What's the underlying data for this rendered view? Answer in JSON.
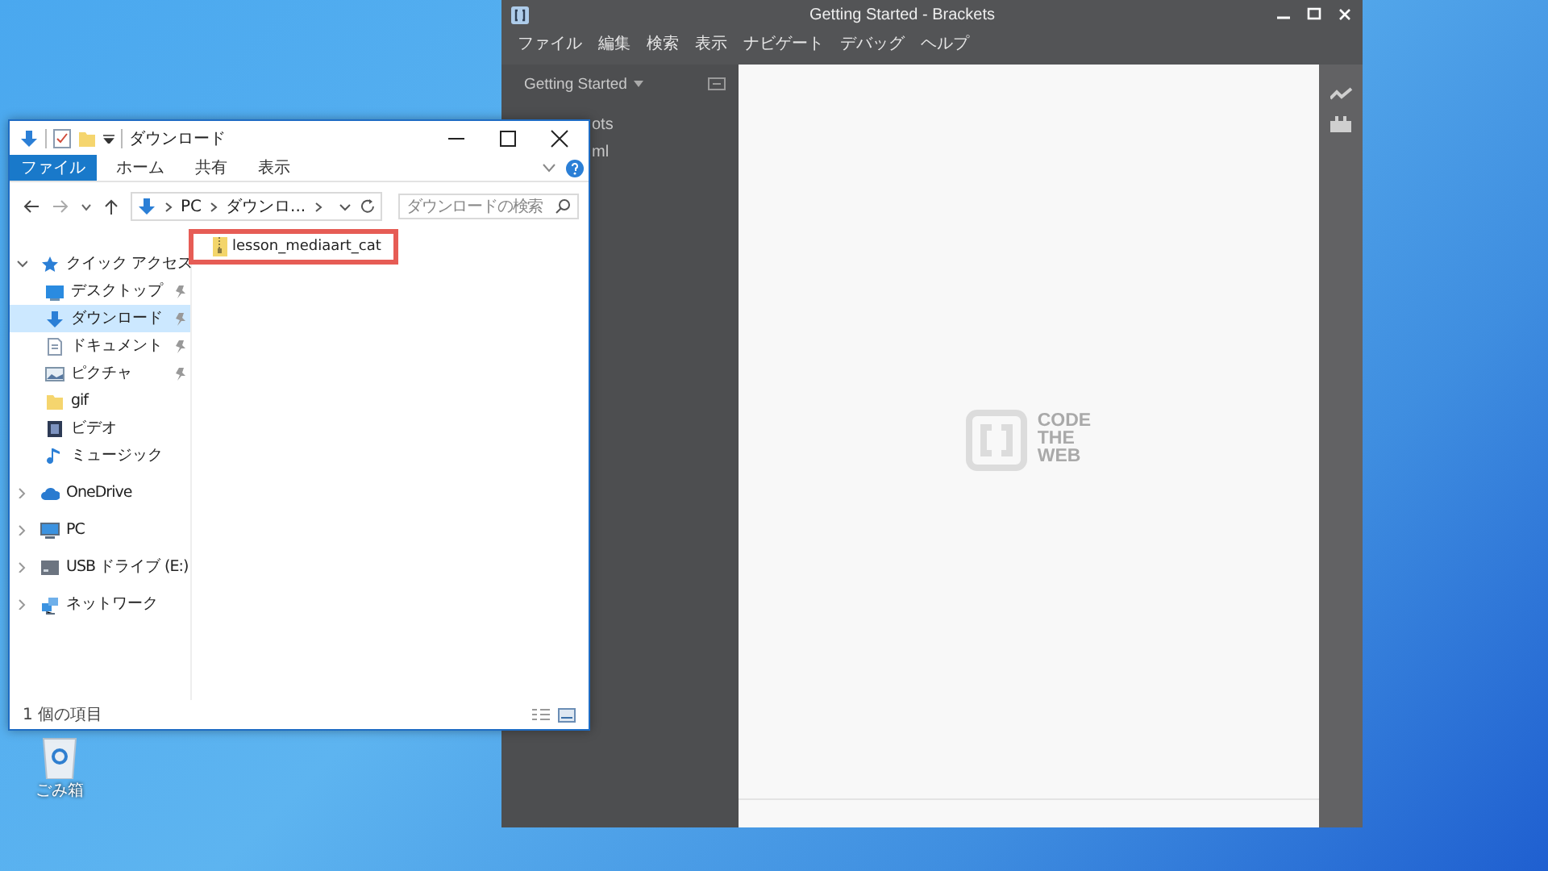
{
  "brackets": {
    "title": "Getting Started - Brackets",
    "menu": [
      "ファイル",
      "編集",
      "検索",
      "表示",
      "ナビゲート",
      "デバッグ",
      "ヘルプ"
    ],
    "project": "Getting Started",
    "files": [
      "ots",
      "ml"
    ],
    "logo_text": [
      "CODE",
      "THE",
      "WEB"
    ]
  },
  "explorer": {
    "title": "ダウンロード",
    "ribbon_tabs": [
      {
        "label": "ファイル",
        "selected": true
      },
      {
        "label": "ホーム",
        "selected": false
      },
      {
        "label": "共有",
        "selected": false
      },
      {
        "label": "表示",
        "selected": false
      }
    ],
    "address": [
      "PC",
      "ダウンロ..."
    ],
    "search": {
      "placeholder": "ダウンロードの検索"
    },
    "nav": [
      {
        "label": "クイック アクセス",
        "kind": "star",
        "expanded": true,
        "selected": false,
        "children": [
          {
            "label": "デスクトップ",
            "kind": "desktop",
            "pinned": true,
            "selected": false
          },
          {
            "label": "ダウンロード",
            "kind": "download",
            "pinned": true,
            "selected": true
          },
          {
            "label": "ドキュメント",
            "kind": "document",
            "pinned": true,
            "selected": false
          },
          {
            "label": "ピクチャ",
            "kind": "pictures",
            "pinned": true,
            "selected": false
          },
          {
            "label": "gif",
            "kind": "folder",
            "pinned": false,
            "selected": false
          },
          {
            "label": "ビデオ",
            "kind": "video",
            "pinned": false,
            "selected": false
          },
          {
            "label": "ミュージック",
            "kind": "music",
            "pinned": false,
            "selected": false
          }
        ]
      },
      {
        "label": "OneDrive",
        "kind": "cloud",
        "expanded": false,
        "selected": false
      },
      {
        "label": "PC",
        "kind": "pc",
        "expanded": false,
        "selected": false
      },
      {
        "label": "USB ドライブ (E:)",
        "kind": "drive",
        "expanded": false,
        "selected": false
      },
      {
        "label": "ネットワーク",
        "kind": "network",
        "expanded": false,
        "selected": false
      }
    ],
    "files": [
      {
        "name": "lesson_mediaart_cat",
        "highlighted": true
      }
    ],
    "status": "1 個の項目"
  },
  "desktop_icons": [
    {
      "label": "ごみ箱"
    }
  ]
}
